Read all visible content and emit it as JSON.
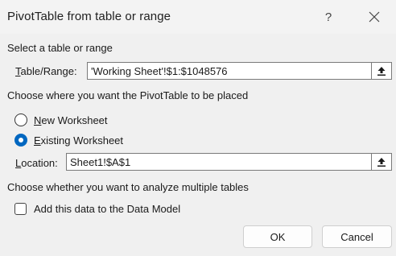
{
  "dialog": {
    "title": "PivotTable from table or range",
    "help_symbol": "?",
    "close_symbol": "✕"
  },
  "source": {
    "heading": "Select a table or range",
    "range_label_accesskey": "T",
    "range_label_rest": "able/Range:",
    "range_value": "'Working Sheet'!$1:$1048576"
  },
  "placement": {
    "heading": "Choose where you want the PivotTable to be placed",
    "options": [
      {
        "accesskey": "N",
        "rest": "ew Worksheet",
        "checked": false
      },
      {
        "accesskey": "E",
        "rest": "xisting Worksheet",
        "checked": true
      }
    ],
    "location_label_accesskey": "L",
    "location_label_rest": "ocation:",
    "location_value": "Sheet1!$A$1"
  },
  "multiple_tables": {
    "heading": "Choose whether you want to analyze multiple tables",
    "add_to_model_label": "Add this data to the Data Model",
    "add_to_model_checked": false
  },
  "buttons": {
    "ok": "OK",
    "cancel": "Cancel"
  },
  "icons": {
    "collapse": "collapse-dialog-icon",
    "help": "help-icon",
    "close": "close-icon"
  },
  "colors": {
    "accent": "#0067c0",
    "background": "#f0f0f0"
  }
}
